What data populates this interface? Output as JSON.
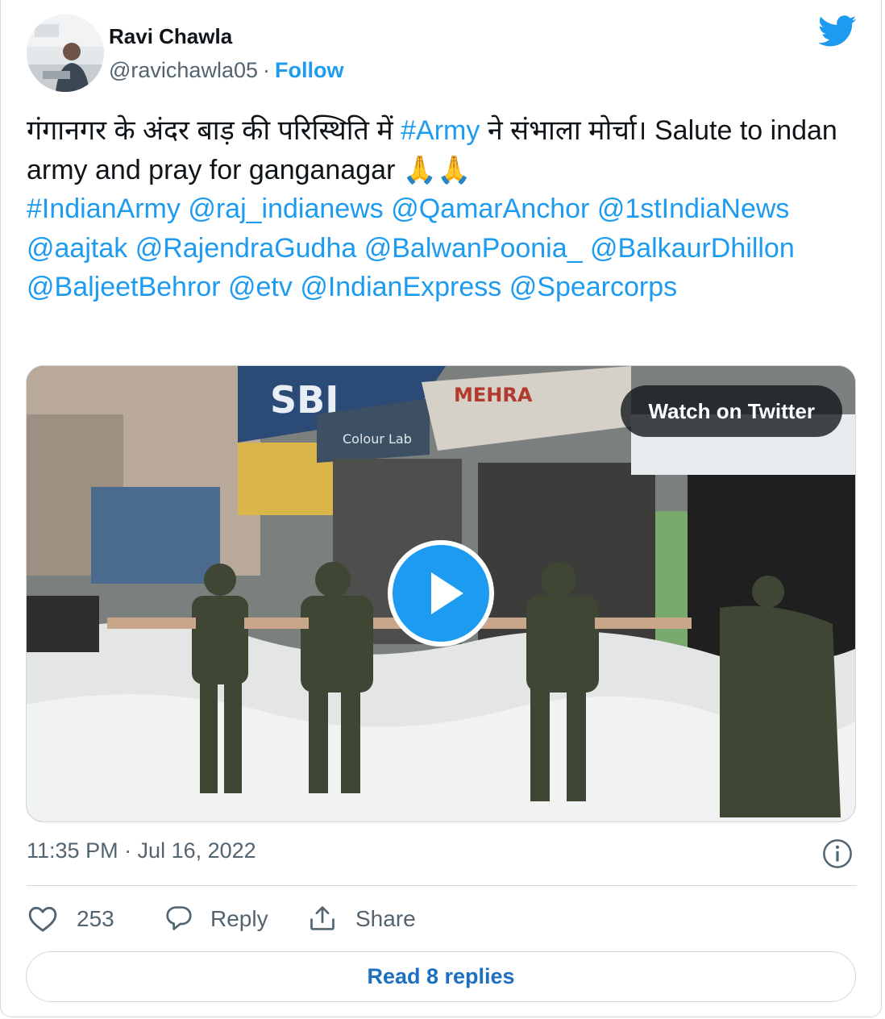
{
  "author": {
    "display_name": "Ravi Chawla",
    "handle": "@ravichawla05",
    "separator": "·",
    "follow_label": "Follow"
  },
  "tweet": {
    "segments": [
      {
        "text": "गंगानगर के अंदर बाड़ की परिस्थिति में ",
        "link": false
      },
      {
        "text": "#Army",
        "link": true
      },
      {
        "text": " ने संभाला मोर्चा। Salute to indan army and pray for ganganagar 🙏🙏\n",
        "link": false
      },
      {
        "text": "#IndianArmy",
        "link": true
      },
      {
        "text": " ",
        "link": false
      },
      {
        "text": "@raj_indianews",
        "link": true
      },
      {
        "text": " ",
        "link": false
      },
      {
        "text": "@QamarAnchor",
        "link": true
      },
      {
        "text": " ",
        "link": false
      },
      {
        "text": "@1stIndiaNews",
        "link": true
      },
      {
        "text": " ",
        "link": false
      },
      {
        "text": "@aajtak",
        "link": true
      },
      {
        "text": " ",
        "link": false
      },
      {
        "text": "@RajendraGudha",
        "link": true
      },
      {
        "text": " ",
        "link": false
      },
      {
        "text": "@BalwanPoonia_",
        "link": true
      },
      {
        "text": " ",
        "link": false
      },
      {
        "text": "@BalkaurDhillon",
        "link": true
      },
      {
        "text": " ",
        "link": false
      },
      {
        "text": "@BaljeetBehror",
        "link": true
      },
      {
        "text": " ",
        "link": false
      },
      {
        "text": "@etv",
        "link": true
      },
      {
        "text": " ",
        "link": false
      },
      {
        "text": "@IndianExpress",
        "link": true
      },
      {
        "text": " ",
        "link": false
      },
      {
        "text": "@Spearcorps",
        "link": true
      }
    ]
  },
  "media": {
    "watch_label": "Watch on Twitter",
    "sign_sbi": "SBI",
    "sign_mehra": "MEHRA",
    "sign_colour": "Colour Lab"
  },
  "meta": {
    "timestamp": "11:35 PM · Jul 16, 2022"
  },
  "actions": {
    "like_count": "253",
    "reply_label": "Reply",
    "share_label": "Share"
  },
  "read_replies_label": "Read 8 replies",
  "icons": {
    "brand": "twitter-bird-icon",
    "like": "heart-icon",
    "reply": "speech-bubble-icon",
    "share": "share-icon",
    "info": "info-icon",
    "play": "play-icon"
  },
  "colors": {
    "accent": "#1d9bf0",
    "text": "#0f1419",
    "muted": "#536471",
    "border": "#cfd9de"
  }
}
